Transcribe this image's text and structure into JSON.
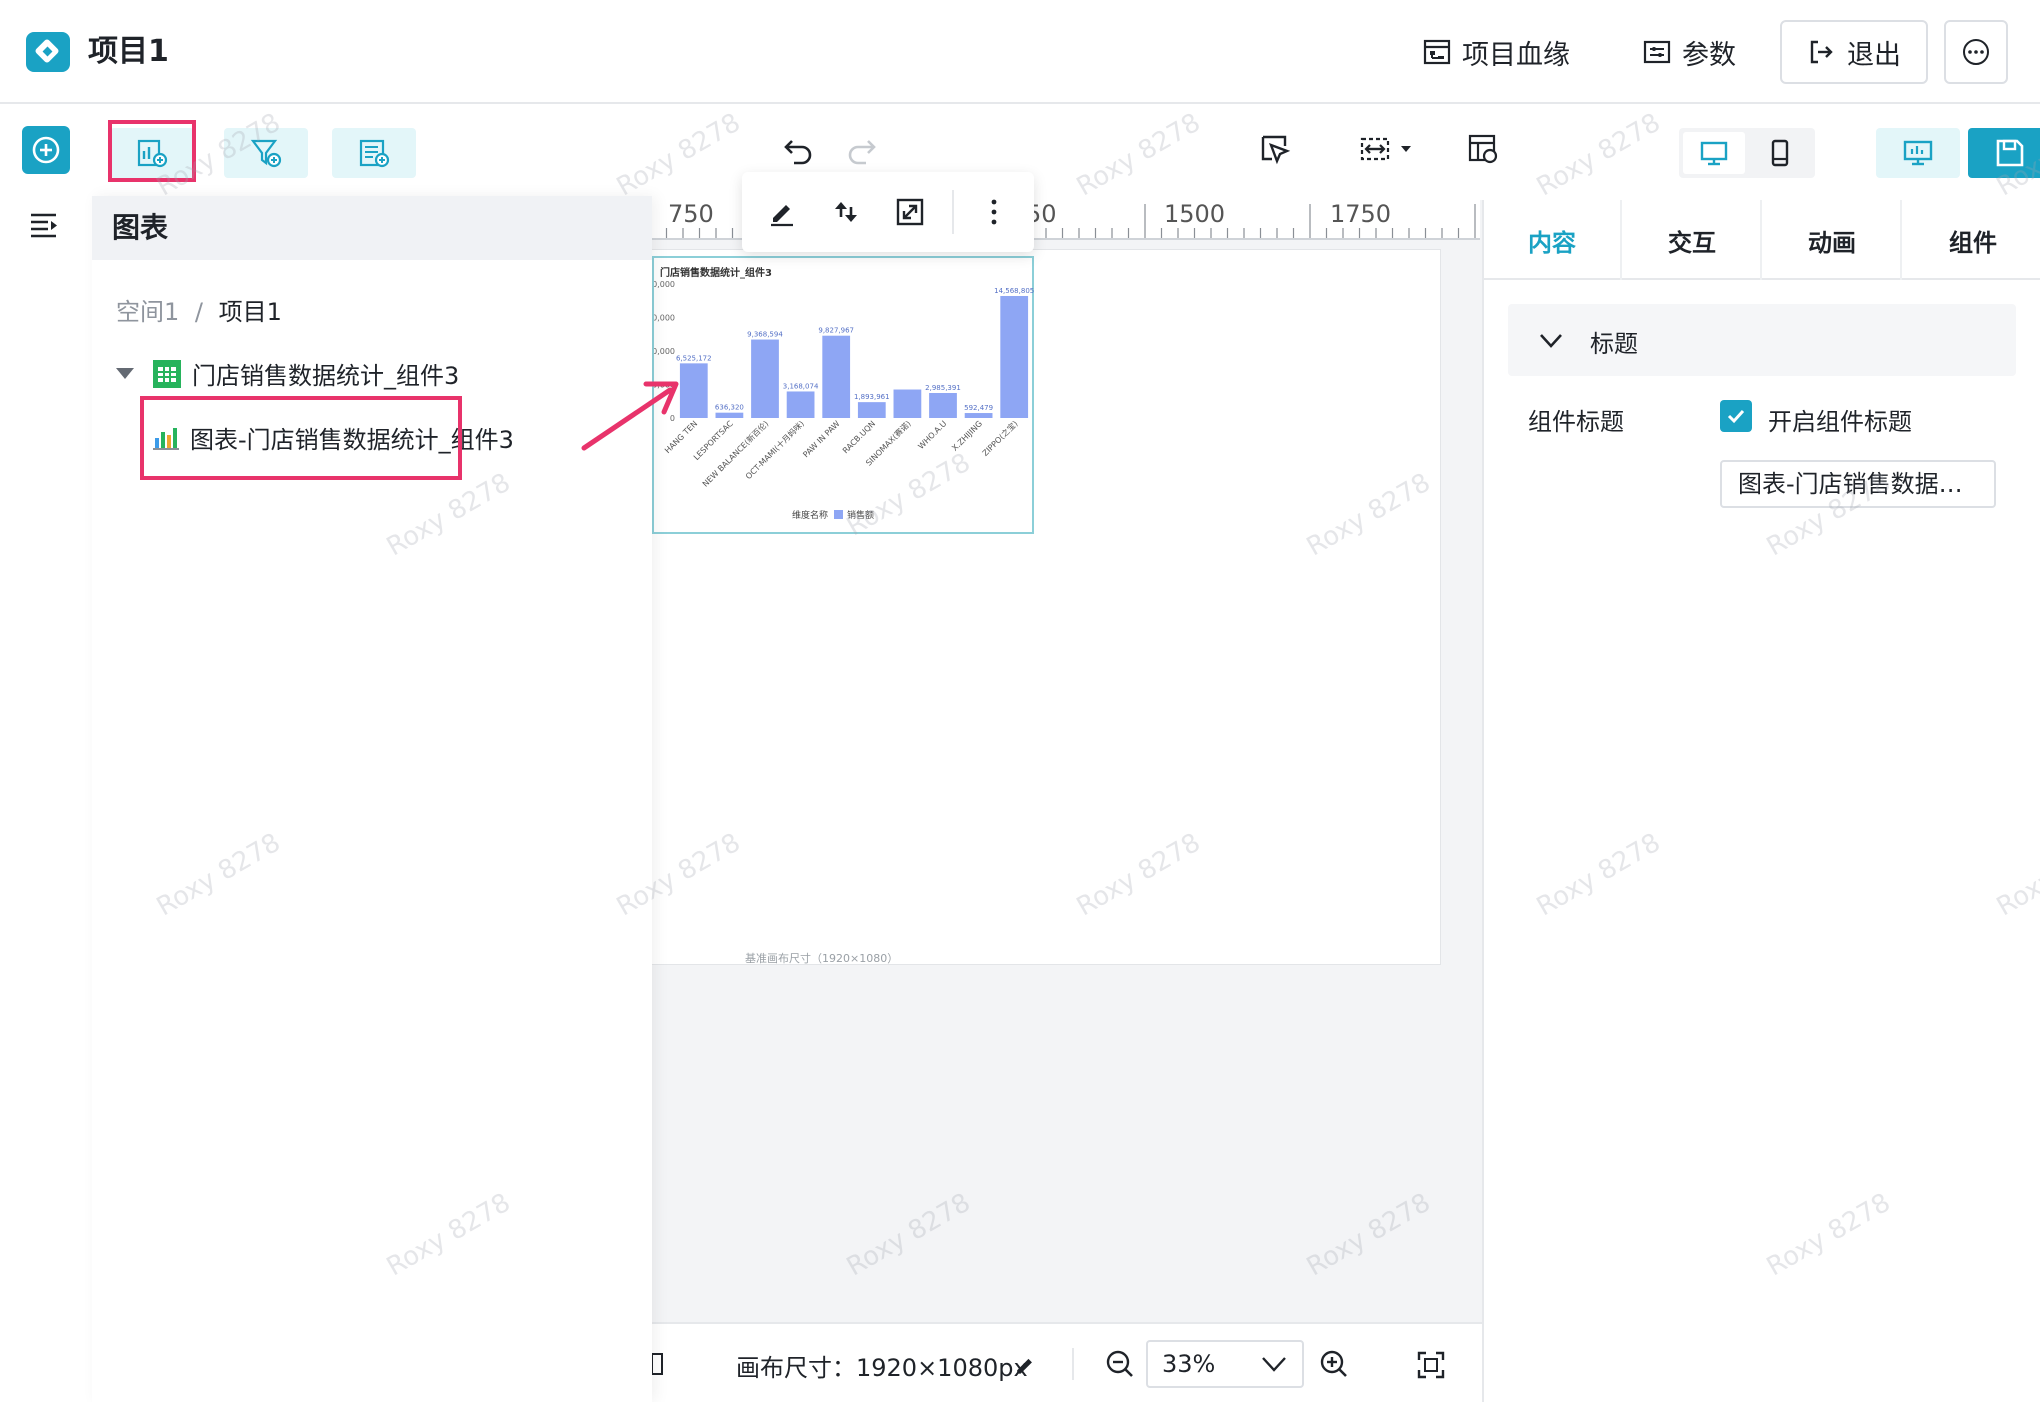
{
  "header": {
    "project_title": "项目1",
    "lineage_label": "项目血缘",
    "params_label": "参数",
    "exit_label": "退出"
  },
  "panel": {
    "title": "图表",
    "breadcrumb": {
      "space": "空间1",
      "separator": "/",
      "project": "项目1"
    },
    "tree": {
      "dataset": "门店销售数据统计_组件3",
      "chart": "图表-门店销售数据统计_组件3"
    }
  },
  "ruler": {
    "labels": [
      "750",
      "50",
      "1500",
      "1750"
    ]
  },
  "chart_data": {
    "type": "bar",
    "title": "门店销售数据统计_组件3",
    "categories": [
      "HANG TEN",
      "LESPORTSAC",
      "NEW BALANCE(新百伦)",
      "OCT-MAMI(十月妈咪)",
      "PAW IN PAW",
      "RACB.UQN",
      "SINOMAX(赛诺)",
      "WHO.A.U",
      "X.ZHIJING",
      "ZIPPO(之宝)"
    ],
    "series": [
      {
        "name": "销售额",
        "values": [
          6525172,
          636320,
          9368594,
          3168074,
          9827967,
          1893961,
          3400000,
          2985391,
          592479,
          14568805
        ]
      }
    ],
    "data_labels": [
      "6,525,172",
      "636,320",
      "9,368,594",
      "3,168,074",
      "9,827,967",
      "1,893,961",
      "",
      "2,985,391",
      "592,479",
      "14,568,805"
    ],
    "y_ticks": [
      "0,000",
      "0,000",
      "0,000",
      "0,000",
      "0"
    ],
    "legend": {
      "dim_label": "维度名称",
      "series_label": "销售额"
    },
    "legend_position": "bottom",
    "ylim": [
      0,
      16000000
    ],
    "colors": {
      "bar": "#8ea6f4"
    }
  },
  "artboard": {
    "note": "基准画布尺寸（1920×1080）"
  },
  "bottom_bar": {
    "canvas_size": "画布尺寸：1920×1080px",
    "zoom": "33%"
  },
  "right_panel": {
    "tabs": [
      "内容",
      "交互",
      "动画",
      "组件"
    ],
    "active_tab": 0,
    "section_title": "标题",
    "field_label": "组件标题",
    "checkbox_label": "开启组件标题",
    "checkbox_checked": true,
    "title_value": "图表-门店销售数据…"
  },
  "watermark": "Roxy 8278",
  "colors": {
    "accent": "#1aa2c4",
    "highlight": "#e8336b"
  }
}
